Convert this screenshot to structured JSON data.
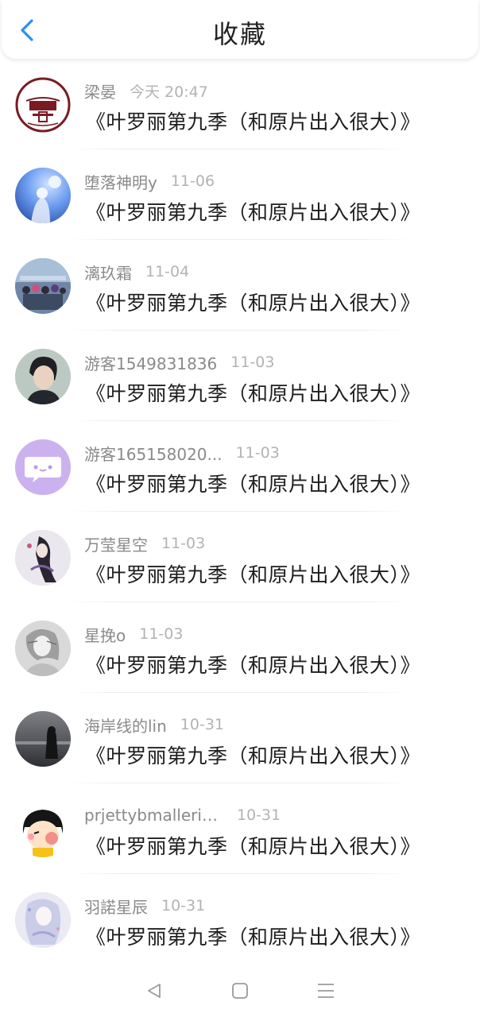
{
  "header": {
    "title": "收藏"
  },
  "items": [
    {
      "username": "梁晏",
      "time": "今天 20:47",
      "title": "《叶罗丽第九季（和原片出入很大）》",
      "avatar": "next-stop-logo"
    },
    {
      "username": "堕落神明y",
      "time": "11-06",
      "title": "《叶罗丽第九季（和原片出入很大）》",
      "avatar": "anime-moon"
    },
    {
      "username": "漓玖霜",
      "time": "11-04",
      "title": "《叶罗丽第九季（和原片出入很大）》",
      "avatar": "group-photo"
    },
    {
      "username": "游客1549831836",
      "time": "11-03",
      "title": "《叶罗丽第九季（和原片出入很大）》",
      "avatar": "boy-portrait"
    },
    {
      "username": "游客165158020...",
      "time": "11-03",
      "title": "《叶罗丽第九季（和原片出入很大）》",
      "avatar": "default-chat"
    },
    {
      "username": "万莹星空",
      "time": "11-03",
      "title": "《叶罗丽第九季（和原片出入很大）》",
      "avatar": "anime-girl-dark"
    },
    {
      "username": "星挽o",
      "time": "11-03",
      "title": "《叶罗丽第九季（和原片出入很大）》",
      "avatar": "sketch-girl"
    },
    {
      "username": "海岸线的lin",
      "time": "10-31",
      "title": "《叶罗丽第九季（和原片出入很大）》",
      "avatar": "seaside-girl"
    },
    {
      "username": "prjettybmallerin...",
      "time": "10-31",
      "title": "《叶罗丽第九季（和原片出入很大）》",
      "avatar": "maruko"
    },
    {
      "username": "羽諾星辰",
      "time": "10-31",
      "title": "《叶罗丽第九季（和原片出入很大）》",
      "avatar": "anime-girl-light"
    }
  ],
  "colors": {
    "accent": "#2a8ff7",
    "divider": "#ececec"
  },
  "navbar": {
    "back": "triangle-back-icon",
    "home": "square-home-icon",
    "menu": "menu-lines-icon"
  }
}
